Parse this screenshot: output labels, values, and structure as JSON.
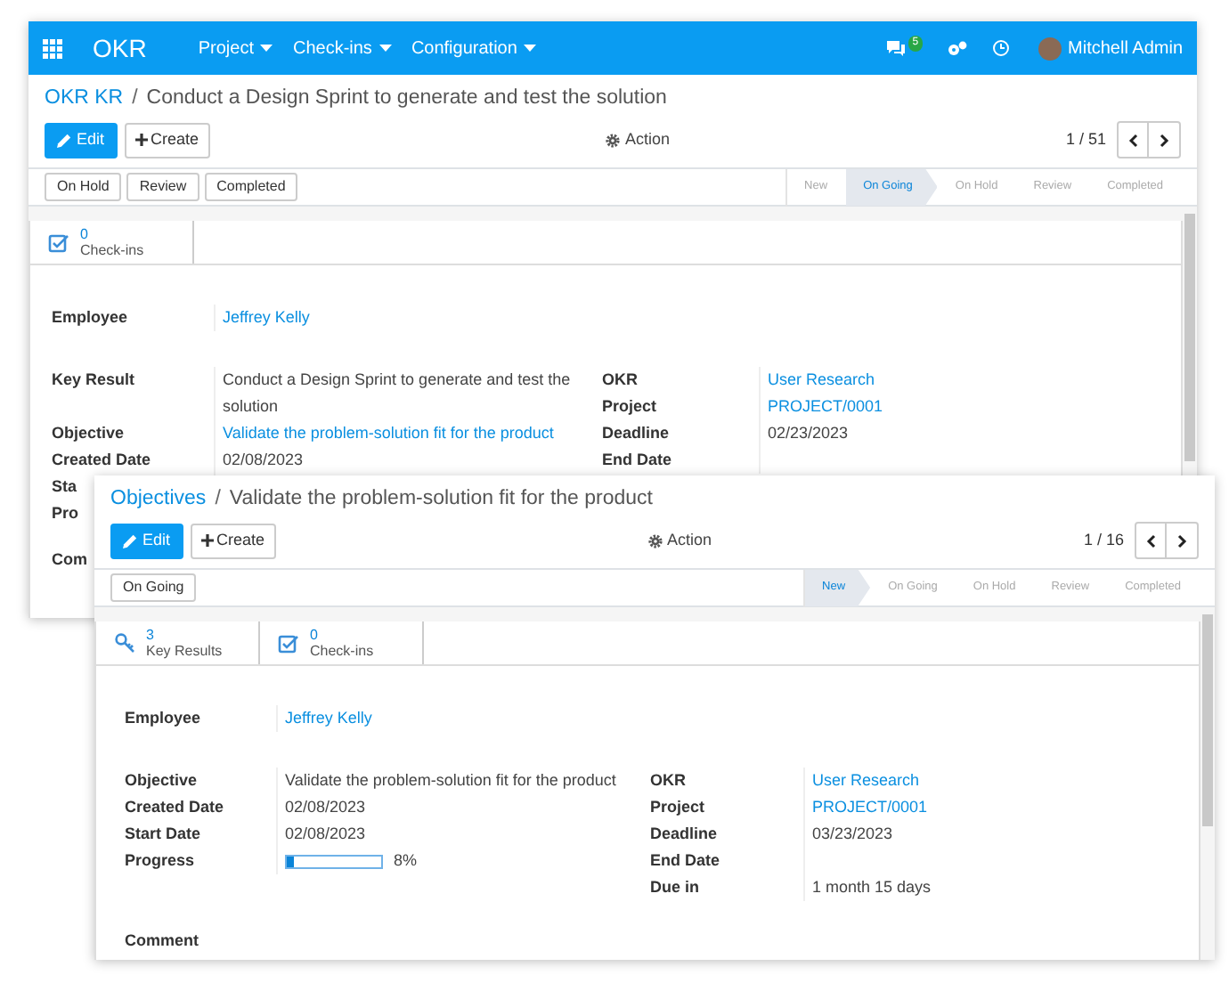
{
  "windows": [
    {
      "navbar": {
        "app_name": "OKR",
        "menus": [
          "Project",
          "Check-ins",
          "Configuration"
        ],
        "message_count": "5",
        "user_name": "Mitchell Admin"
      },
      "breadcrumb": {
        "parent": "OKR KR",
        "separator": "/",
        "current": "Conduct a Design Sprint to generate and test the solution"
      },
      "buttons": {
        "edit": "Edit",
        "create": "Create",
        "action": "Action"
      },
      "pager": "1 / 51",
      "status_buttons": [
        "On Hold",
        "Review",
        "Completed"
      ],
      "stages": [
        {
          "label": "New",
          "selected": false
        },
        {
          "label": "On Going",
          "selected": true
        },
        {
          "label": "On Hold",
          "selected": false
        },
        {
          "label": "Review",
          "selected": false
        },
        {
          "label": "Completed",
          "selected": false
        }
      ],
      "smart_buttons": [
        {
          "kind": "checkins",
          "count": "0",
          "label": "Check-ins"
        }
      ],
      "employee": {
        "label": "Employee",
        "value": "Jeffrey Kelly"
      },
      "left_fields": [
        {
          "kind": "text",
          "label": "Key Result",
          "value": "Conduct a Design Sprint to generate and test the solution"
        },
        {
          "kind": "link",
          "label": "Objective",
          "value": "Validate the problem-solution fit for the product"
        },
        {
          "kind": "text",
          "label": "Created Date",
          "value": "02/08/2023"
        },
        {
          "kind": "text",
          "label": "Sta"
        },
        {
          "kind": "text",
          "label": "Pro"
        }
      ],
      "right_fields": [
        {
          "kind": "link",
          "label": "OKR",
          "value": "User Research"
        },
        {
          "kind": "link",
          "label": "Project",
          "value": "PROJECT/0001"
        },
        {
          "kind": "text",
          "label": "Deadline",
          "value": "02/23/2023"
        },
        {
          "kind": "text",
          "label": "End Date"
        }
      ],
      "comment_label": "Com"
    },
    {
      "breadcrumb": {
        "parent": "Objectives",
        "separator": "/",
        "current": "Validate the problem-solution fit for the product"
      },
      "buttons": {
        "edit": "Edit",
        "create": "Create",
        "action": "Action"
      },
      "pager": "1 / 16",
      "status_buttons": [
        "On Going"
      ],
      "stages": [
        {
          "label": "New",
          "selected": true
        },
        {
          "label": "On Going",
          "selected": false
        },
        {
          "label": "On Hold",
          "selected": false
        },
        {
          "label": "Review",
          "selected": false
        },
        {
          "label": "Completed",
          "selected": false
        }
      ],
      "smart_buttons": [
        {
          "kind": "key_results",
          "count": "3",
          "label": "Key Results"
        },
        {
          "kind": "checkins",
          "count": "0",
          "label": "Check-ins"
        }
      ],
      "employee": {
        "label": "Employee",
        "value": "Jeffrey Kelly"
      },
      "left_fields": [
        {
          "kind": "text",
          "label": "Objective",
          "value": "Validate the problem-solution fit for the product"
        },
        {
          "kind": "text",
          "label": "Created Date",
          "value": "02/08/2023"
        },
        {
          "kind": "text",
          "label": "Start Date",
          "value": "02/08/2023"
        },
        {
          "kind": "progress",
          "label": "Progress",
          "level": 0.08,
          "reading": "8%"
        }
      ],
      "right_fields": [
        {
          "kind": "link",
          "label": "OKR",
          "value": "User Research"
        },
        {
          "kind": "link",
          "label": "Project",
          "value": "PROJECT/0001"
        },
        {
          "kind": "text",
          "label": "Deadline",
          "value": "03/23/2023"
        },
        {
          "kind": "text",
          "label": "End Date"
        },
        {
          "kind": "text",
          "label": "Due in",
          "value": "1 month 15 days"
        }
      ],
      "comment_label": "Comment"
    }
  ]
}
